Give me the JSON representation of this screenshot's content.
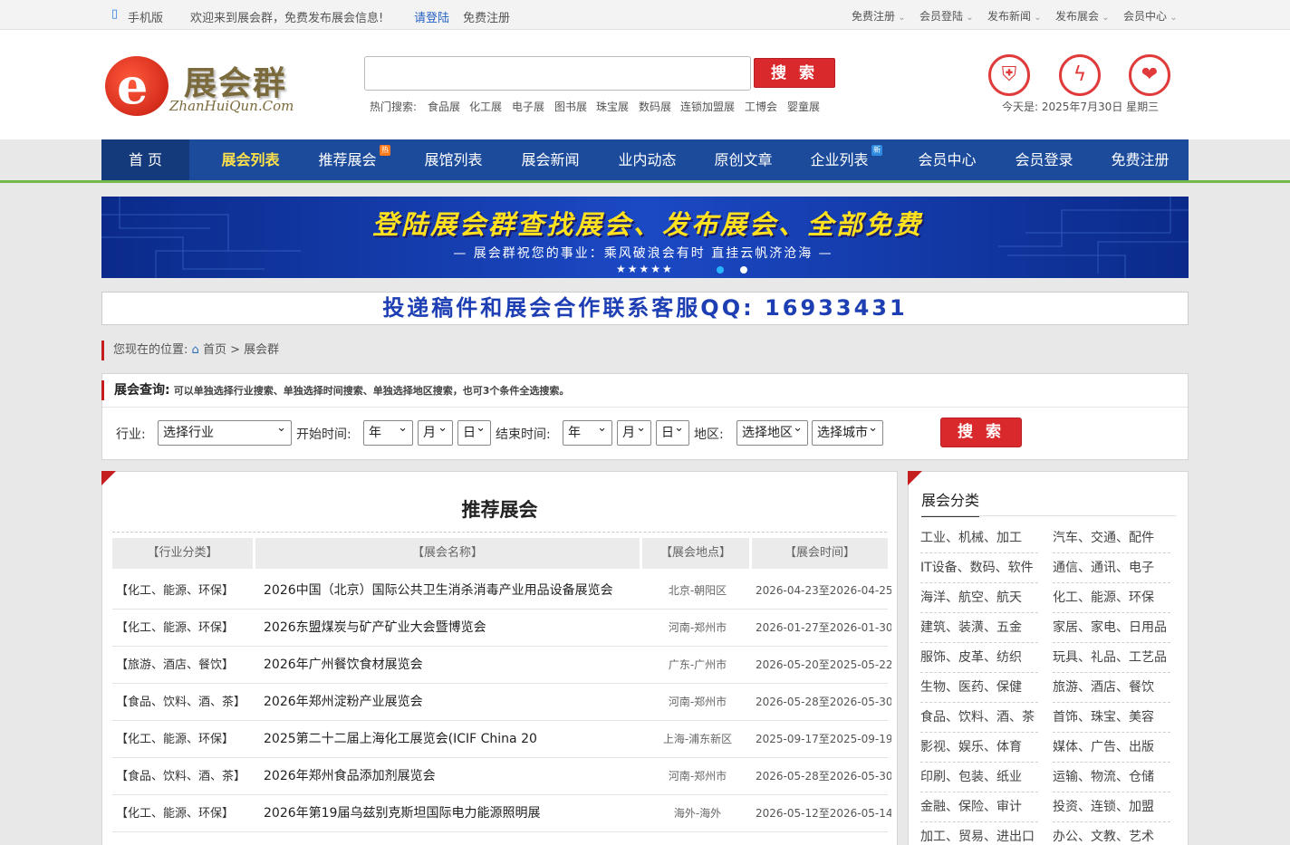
{
  "topbar": {
    "mobile": "手机版",
    "welcome": "欢迎来到展会群，免费发布展会信息!",
    "login": "请登陆",
    "register": "免费注册",
    "right_links": [
      "免费注册",
      "会员登陆",
      "发布新闻",
      "发布展会",
      "会员中心"
    ]
  },
  "logo": {
    "cn": "展会群",
    "en": "ZhanHuiQun.Com",
    "mark": "e"
  },
  "search": {
    "placeholder": "",
    "button": "搜 索",
    "hot_label": "热门搜索:",
    "hot": [
      "食品展",
      "化工展",
      "电子展",
      "图书展",
      "珠宝展",
      "数码展",
      "连锁加盟展",
      "工博会",
      "婴童展"
    ]
  },
  "date": {
    "label": "今天是:",
    "value": "2025年7月30日",
    "weekday": "星期三"
  },
  "nav": {
    "items": [
      "首 页",
      "展会列表",
      "推荐展会",
      "展馆列表",
      "展会新闻",
      "业内动态",
      "原创文章",
      "企业列表",
      "会员中心",
      "会员登录",
      "免费注册"
    ],
    "tags": {
      "hot": "热",
      "new": "新"
    }
  },
  "banner": {
    "main": "登陆展会群查找展会、发布展会、全部免费",
    "sub": "— 展会群祝您的事业：乘风破浪会有时 直挂云帆济沧海 —"
  },
  "qq_bar": "投递稿件和展会合作联系客服QQ: 16933431",
  "breadcrumb": {
    "label": "您现在的位置:",
    "home": "首页",
    "sep": ">",
    "current": "展会群"
  },
  "query": {
    "title": "展会查询:",
    "hint": "可以单独选择行业搜索、单独选择时间搜索、单独选择地区搜索，也可3个条件全选搜索。",
    "industry_label": "行业:",
    "industry_value": "选择行业",
    "start_label": "开始时间:",
    "end_label": "结束时间:",
    "year": "年",
    "month": "月",
    "day": "日",
    "region_label": "地区:",
    "region_value": "选择地区",
    "city_value": "选择城市",
    "button": "搜 索"
  },
  "recommend": {
    "title": "推荐展会",
    "headers": [
      "【行业分类】",
      "【展会名称】",
      "【展会地点】",
      "【展会时间】"
    ],
    "rows": [
      {
        "industry": "【化工、能源、环保】",
        "name": "2026中国（北京）国际公共卫生消杀消毒产业用品设备展览会",
        "location": "北京-朝阳区",
        "time": "2026-04-23至2026-04-25"
      },
      {
        "industry": "【化工、能源、环保】",
        "name": "2026东盟煤炭与矿产矿业大会暨博览会",
        "location": "河南-郑州市",
        "time": "2026-01-27至2026-01-30"
      },
      {
        "industry": "【旅游、酒店、餐饮】",
        "name": "2026年广州餐饮食材展览会",
        "location": "广东-广州市",
        "time": "2026-05-20至2025-05-22"
      },
      {
        "industry": "【食品、饮料、酒、茶】",
        "name": "2026年郑州淀粉产业展览会",
        "location": "河南-郑州市",
        "time": "2026-05-28至2026-05-30"
      },
      {
        "industry": "【化工、能源、环保】",
        "name": "2025第二十二届上海化工展览会(ICIF China  20",
        "location": "上海-浦东新区",
        "time": "2025-09-17至2025-09-19"
      },
      {
        "industry": "【食品、饮料、酒、茶】",
        "name": "2026年郑州食品添加剂展览会",
        "location": "河南-郑州市",
        "time": "2026-05-28至2026-05-30"
      },
      {
        "industry": "【化工、能源、环保】",
        "name": "2026年第19届乌兹别克斯坦国际电力能源照明展",
        "location": "海外-海外",
        "time": "2026-05-12至2026-05-14"
      }
    ]
  },
  "categories": {
    "title": "展会分类",
    "items": [
      "工业、机械、加工",
      "汽车、交通、配件",
      "IT设备、数码、软件",
      "通信、通讯、电子",
      "海洋、航空、航天",
      "化工、能源、环保",
      "建筑、装潢、五金",
      "家居、家电、日用品",
      "服饰、皮革、纺织",
      "玩具、礼品、工艺品",
      "生物、医药、保健",
      "旅游、酒店、餐饮",
      "食品、饮料、酒、茶",
      "首饰、珠宝、美容",
      "影视、娱乐、体育",
      "媒体、广告、出版",
      "印刷、包装、纸业",
      "运输、物流、仓储",
      "金融、保险、审计",
      "投资、连锁、加盟",
      "加工、贸易、进出口",
      "办公、文教、艺术"
    ]
  },
  "colors": {
    "brand_blue": "#1c4b9c",
    "accent_red": "#d9292c",
    "nav_active": "#ffe14a",
    "green_line": "#73b84a"
  }
}
